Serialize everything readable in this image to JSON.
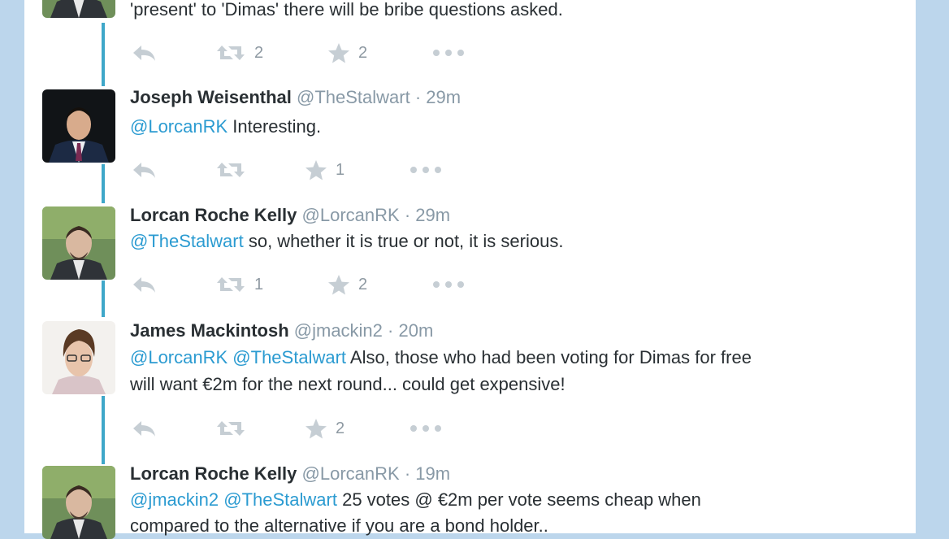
{
  "tweets": [
    {
      "body_segments": [
        {
          "text": "'present' to 'Dimas' there will be bribe questions asked.",
          "mention": false
        }
      ],
      "retweets": "2",
      "favorites": "2"
    },
    {
      "name": "Joseph Weisenthal",
      "handle": "@TheStalwart",
      "sep": "·",
      "time": "29m",
      "body_segments": [
        {
          "text": "@LorcanRK",
          "mention": true
        },
        {
          "text": " Interesting.",
          "mention": false
        }
      ],
      "retweets": "",
      "favorites": "1"
    },
    {
      "name": "Lorcan Roche Kelly",
      "handle": "@LorcanRK",
      "sep": "·",
      "time": "29m",
      "body_segments": [
        {
          "text": "@TheStalwart",
          "mention": true
        },
        {
          "text": " so, whether it is true or not, it is serious.",
          "mention": false
        }
      ],
      "retweets": "1",
      "favorites": "2"
    },
    {
      "name": "James Mackintosh",
      "handle": "@jmackin2",
      "sep": "·",
      "time": "20m",
      "body_segments": [
        {
          "text": "@LorcanRK",
          "mention": true
        },
        {
          "text": " ",
          "mention": false
        },
        {
          "text": "@TheStalwart",
          "mention": true
        },
        {
          "text": " Also, those who had been voting for Dimas for free",
          "mention": false
        }
      ],
      "body_line2": "will want €2m for the next round... could get expensive!",
      "retweets": "",
      "favorites": "2"
    },
    {
      "name": "Lorcan Roche Kelly",
      "handle": "@LorcanRK",
      "sep": "·",
      "time": "19m",
      "body_segments": [
        {
          "text": "@jmackin2",
          "mention": true
        },
        {
          "text": " ",
          "mention": false
        },
        {
          "text": "@TheStalwart",
          "mention": true
        },
        {
          "text": " 25 votes @ €2m per vote seems cheap when",
          "mention": false
        }
      ],
      "body_line2": "compared to the alternative if you are a bond holder..",
      "retweets": "",
      "favorites": ""
    }
  ],
  "colors": {
    "background": "#bcd6ec",
    "thread_line": "#3fa7c9",
    "mention": "#2b9bd1",
    "meta": "#8899a6",
    "icon": "#c6ced4"
  },
  "icons": [
    "reply-icon",
    "retweet-icon",
    "favorite-star-icon",
    "more-dots-icon"
  ]
}
